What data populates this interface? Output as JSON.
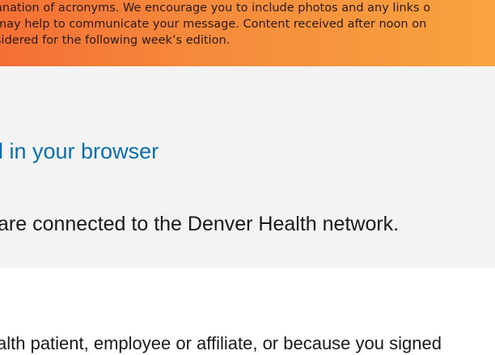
{
  "banner": {
    "lines": [
      "anation of acronyms. We encourage you to include photos and any links o",
      "may help to communicate your message. Content received after noon on",
      "sidered for the following week’s edition."
    ]
  },
  "panel": {
    "view_in_browser_link": "l in your browser",
    "network_note": "are connected to the Denver Health network."
  },
  "footer": {
    "text": "alth patient, employee or affiliate, or because you signed"
  }
}
